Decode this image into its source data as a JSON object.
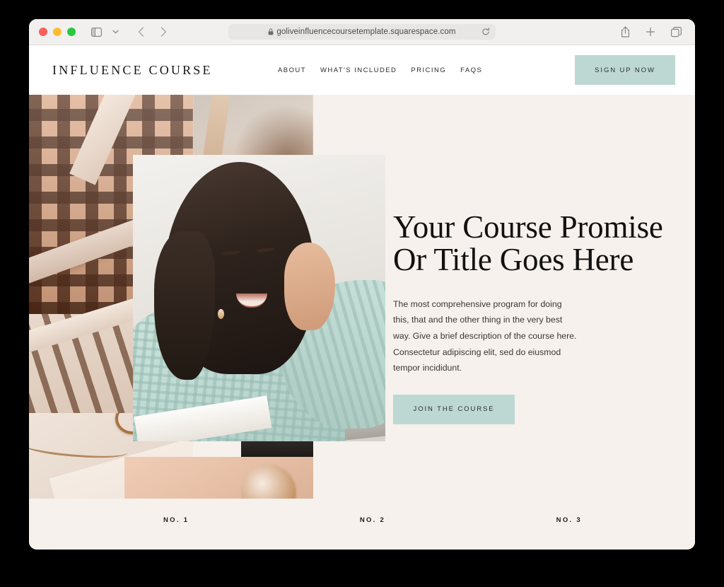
{
  "browser": {
    "url": "goliveinfluencecoursetemplate.squarespace.com",
    "lock_icon": "lock-icon",
    "reload_icon": "reload-icon",
    "sidebar_icon": "sidebar-toggle-icon",
    "chevron_icon": "chevron-down-icon",
    "back_icon": "back-arrow-icon",
    "forward_icon": "forward-arrow-icon",
    "share_icon": "share-icon",
    "new_tab_icon": "plus-icon",
    "tabs_icon": "tab-overview-icon",
    "traffic_lights": [
      "close",
      "minimize",
      "zoom"
    ]
  },
  "site": {
    "logo": "INFLUENCE COURSE",
    "nav": [
      {
        "label": "ABOUT"
      },
      {
        "label": "WHAT'S INCLUDED"
      },
      {
        "label": "PRICING"
      },
      {
        "label": "FAQS"
      }
    ],
    "signup_button": "SIGN UP NOW"
  },
  "hero": {
    "headline_line1": "Your Course Promise",
    "headline_line2": "Or Title Goes Here",
    "body": "The most comprehensive program for doing this, that and the other thing in the very best way. Give a brief description of the course here. Consectetur adipiscing elit, sed do eiusmod tempor incididunt.",
    "cta_button": "JOIN THE COURSE",
    "numbers": [
      {
        "label": "NO. 1"
      },
      {
        "label": "NO. 2"
      },
      {
        "label": "NO. 3"
      }
    ]
  },
  "colors": {
    "page_background": "#000000",
    "toolbar": "#f1f0ef",
    "site_header": "#ffffff",
    "hero_background": "#f6f1ec",
    "accent_mint": "#bdd8d2",
    "text_dark": "#12110f"
  }
}
